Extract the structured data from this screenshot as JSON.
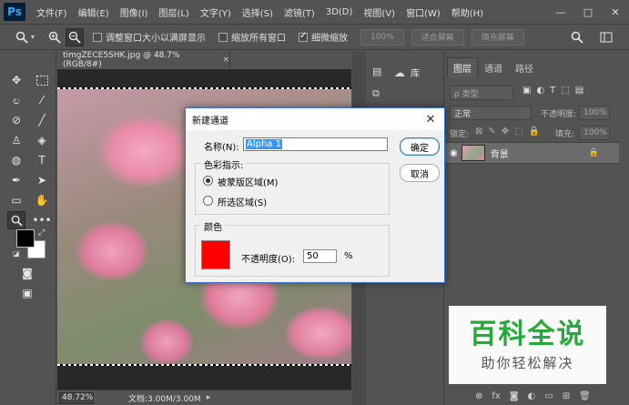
{
  "app": {
    "logo": "Ps"
  },
  "menu": [
    "文件(F)",
    "编辑(E)",
    "图像(I)",
    "图层(L)",
    "文字(Y)",
    "选择(S)",
    "滤镜(T)",
    "3D(D)",
    "视图(V)",
    "窗口(W)",
    "帮助(H)"
  ],
  "window_controls": {
    "minimize": "—",
    "maximize": "□",
    "close": "✕"
  },
  "options": {
    "resize_windows": "调整窗口大小以满屏显示",
    "zoom_all": "缩放所有窗口",
    "scrubby_zoom": "细微缩放",
    "zoom_value": "100%",
    "fit_screen": "适合屏幕",
    "fill_screen": "填充屏幕",
    "resize_checked": false,
    "zoom_all_checked": false,
    "scrubby_checked": true
  },
  "document": {
    "tab_title": "timgZECE5SHK.jpg @ 48.7%(RGB/8#)",
    "tab_close": "×",
    "zoom": "48.72%",
    "doc_info": "文档:3.00M/3.00M"
  },
  "dock": {
    "library_label": "库"
  },
  "layers_panel": {
    "tabs": [
      "图层",
      "通道",
      "路径"
    ],
    "kind_placeholder": "ρ 类型",
    "blend_mode": "正常",
    "opacity_label": "不透明度:",
    "opacity_value": "100%",
    "lock_label": "锁定:",
    "fill_label": "填充:",
    "fill_value": "100%",
    "layer_name": "背景"
  },
  "dialog": {
    "title": "新建通道",
    "name_label": "名称(N):",
    "name_value": "Alpha 1",
    "ok": "确定",
    "cancel": "取消",
    "color_indicates": "色彩指示:",
    "masked_areas": "被蒙版区域(M)",
    "selected_areas": "所选区域(S)",
    "masked_selected": true,
    "color_group": "颜色",
    "opacity_label": "不透明度(O):",
    "opacity_value": "50",
    "percent": "%",
    "swatch_color": "#ff0000"
  },
  "watermark": {
    "title": "百科全说",
    "subtitle": "助你轻松解决"
  },
  "colors": {
    "foreground": "#000000",
    "background": "#ffffff",
    "watermark_green": "#27a83a"
  }
}
